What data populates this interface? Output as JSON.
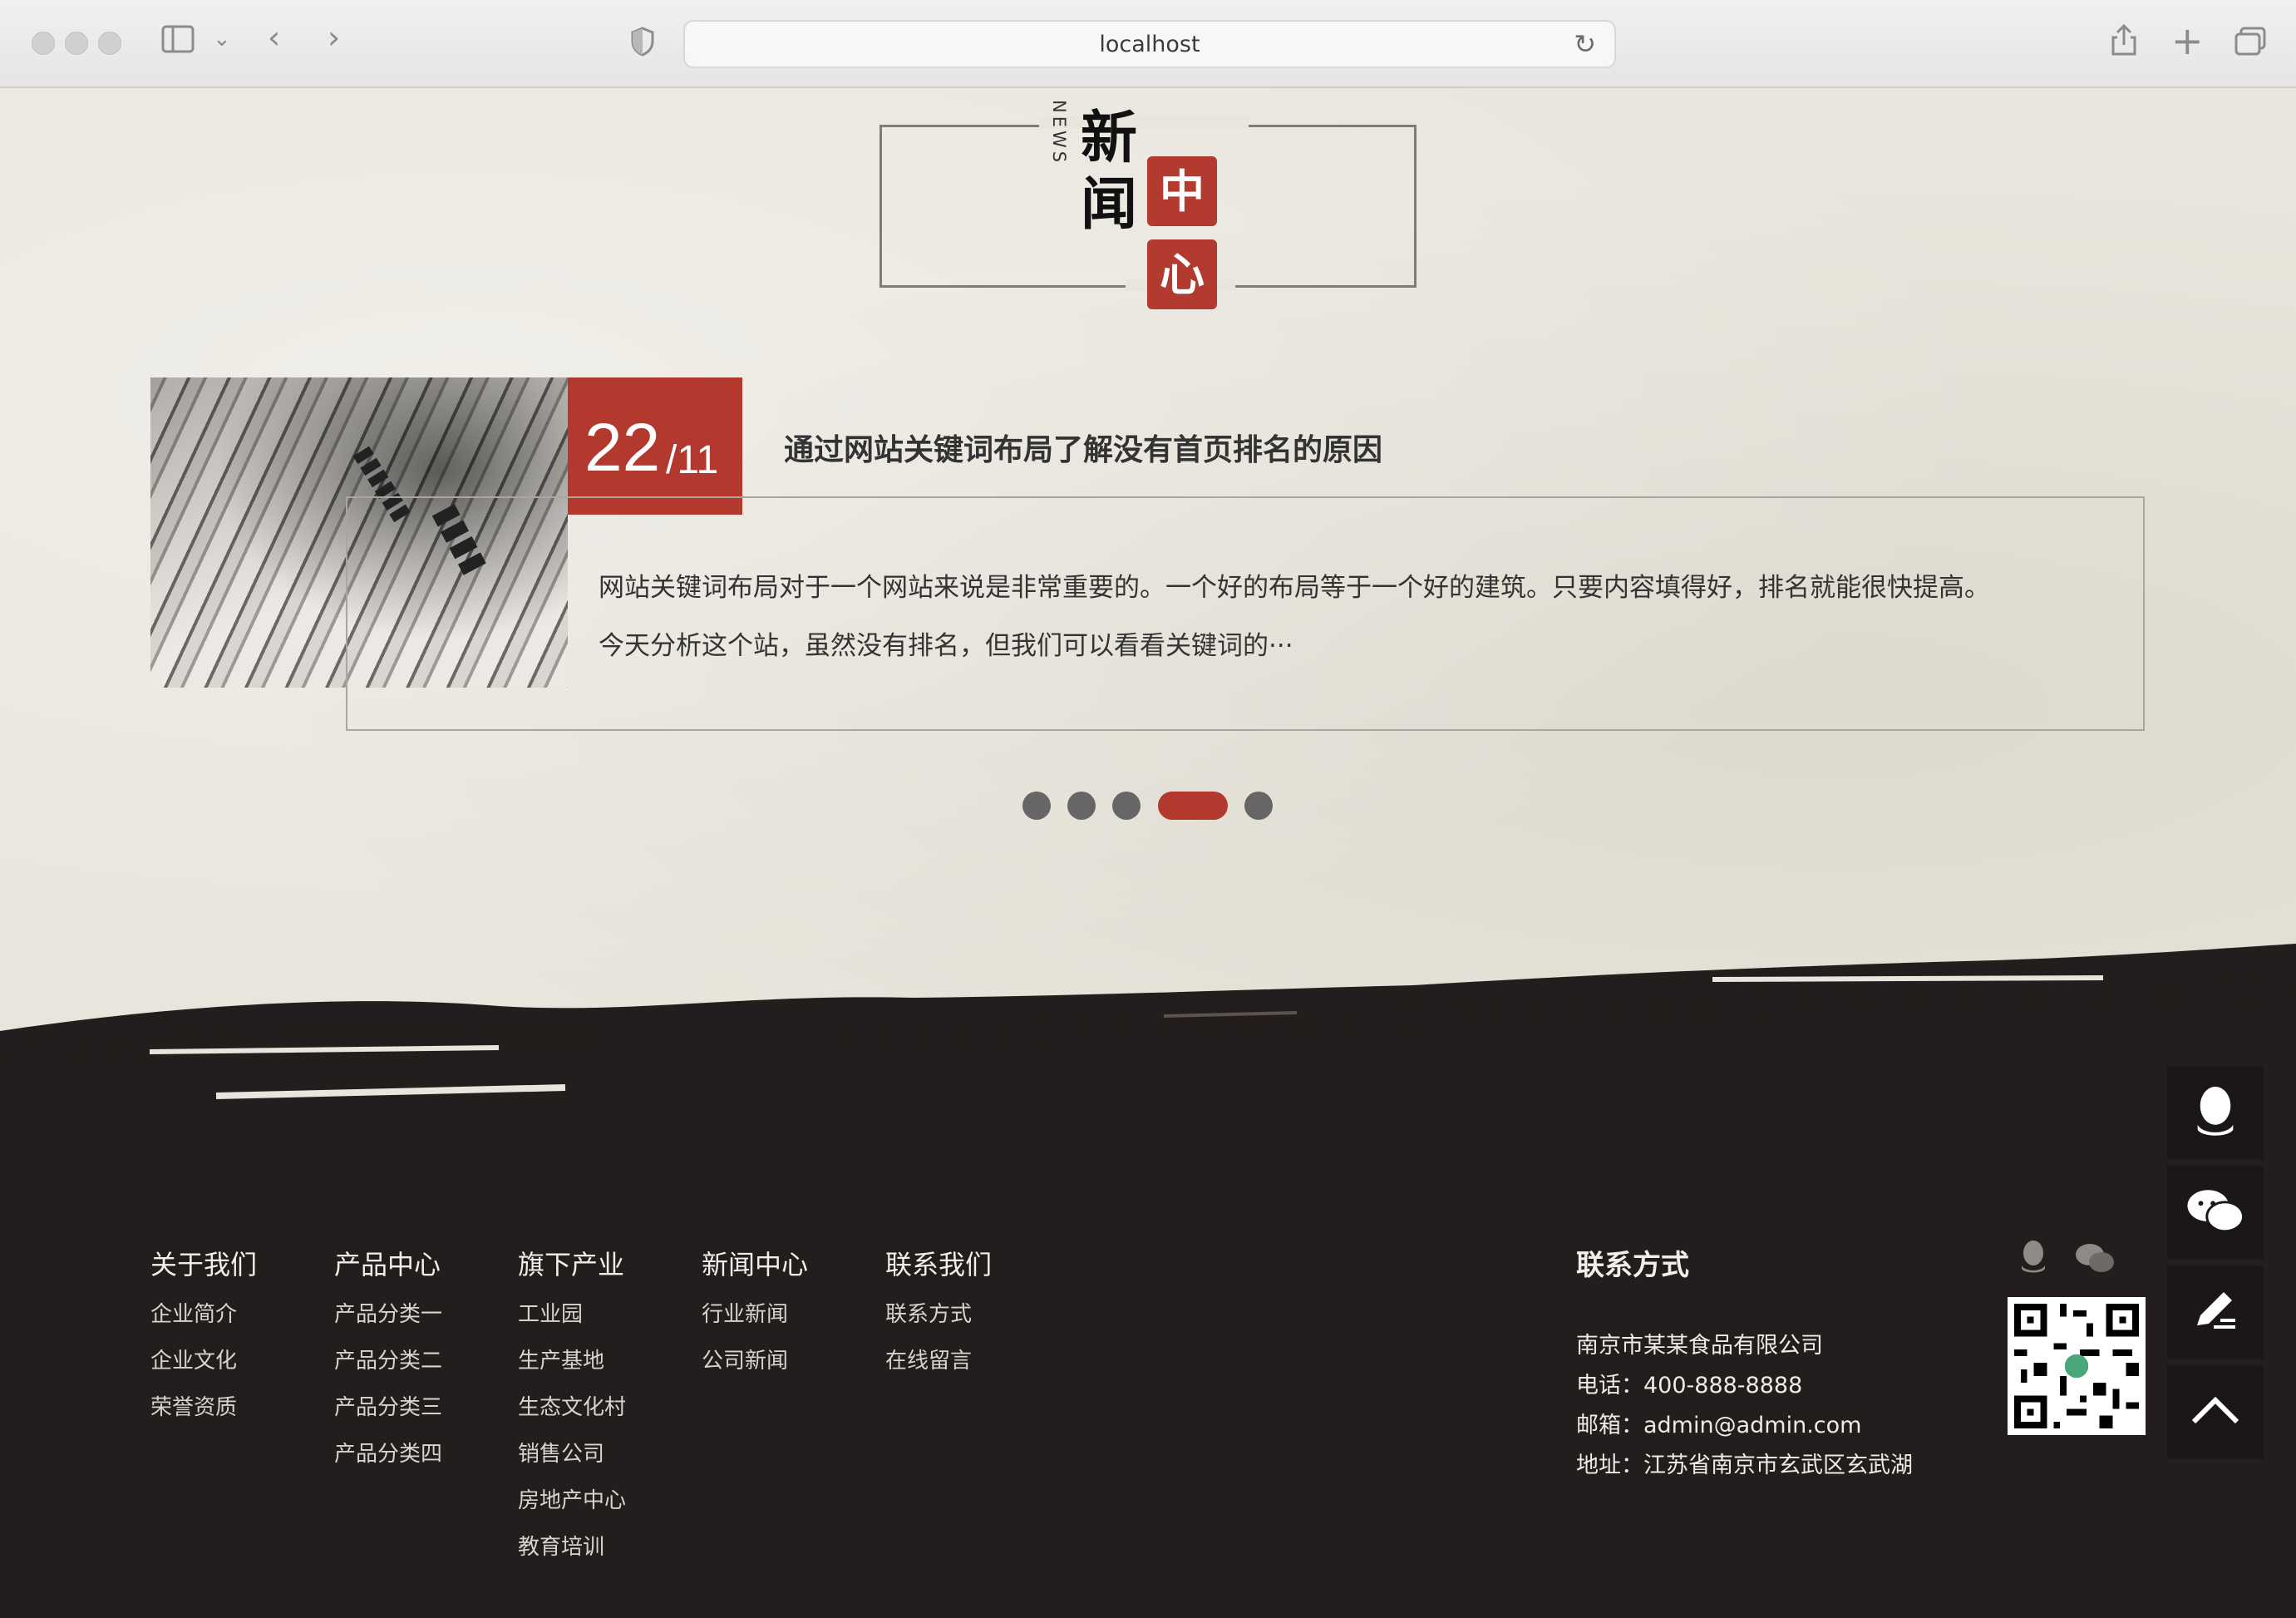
{
  "browser": {
    "url": "localhost"
  },
  "section": {
    "title_en": "NEWS",
    "title_chars": [
      "新",
      "闻",
      "中",
      "心"
    ]
  },
  "news": {
    "day": "22",
    "month": "/11",
    "title": "通过网站关键词布局了解没有首页排名的原因",
    "summary_line1": "网站关键词布局对于一个网站来说是非常重要的。一个好的布局等于一个好的建筑。只要内容填得好，排名就能很快提高。",
    "summary_line2": "今天分析这个站，虽然没有排名，但我们可以看看关键词的···",
    "carousel": {
      "count": 5,
      "active_index": 3
    }
  },
  "footer": {
    "columns": [
      {
        "title": "关于我们",
        "links": [
          "企业简介",
          "企业文化",
          "荣誉资质"
        ]
      },
      {
        "title": "产品中心",
        "links": [
          "产品分类一",
          "产品分类二",
          "产品分类三",
          "产品分类四"
        ]
      },
      {
        "title": "旗下产业",
        "links": [
          "工业园",
          "生产基地",
          "生态文化村",
          "销售公司",
          "房地产中心",
          "教育培训"
        ]
      },
      {
        "title": "新闻中心",
        "links": [
          "行业新闻",
          "公司新闻"
        ]
      },
      {
        "title": "联系我们",
        "links": [
          "联系方式",
          "在线留言"
        ]
      }
    ],
    "contact": {
      "title": "联系方式",
      "company": "南京市某某食品有限公司",
      "phone": "电话：400-888-8888",
      "email": "邮箱：admin@admin.com",
      "address": "地址：江苏省南京市玄武区玄武湖"
    },
    "social_icons": [
      "qq-icon",
      "wechat-icon"
    ]
  },
  "sidebar": {
    "buttons": [
      "qq-icon",
      "wechat-icon",
      "edit-icon",
      "back-to-top-icon"
    ]
  },
  "colors": {
    "accent": "#b3382d",
    "footer_bg": "#231e1d",
    "page_bg": "#e8e5dc"
  }
}
